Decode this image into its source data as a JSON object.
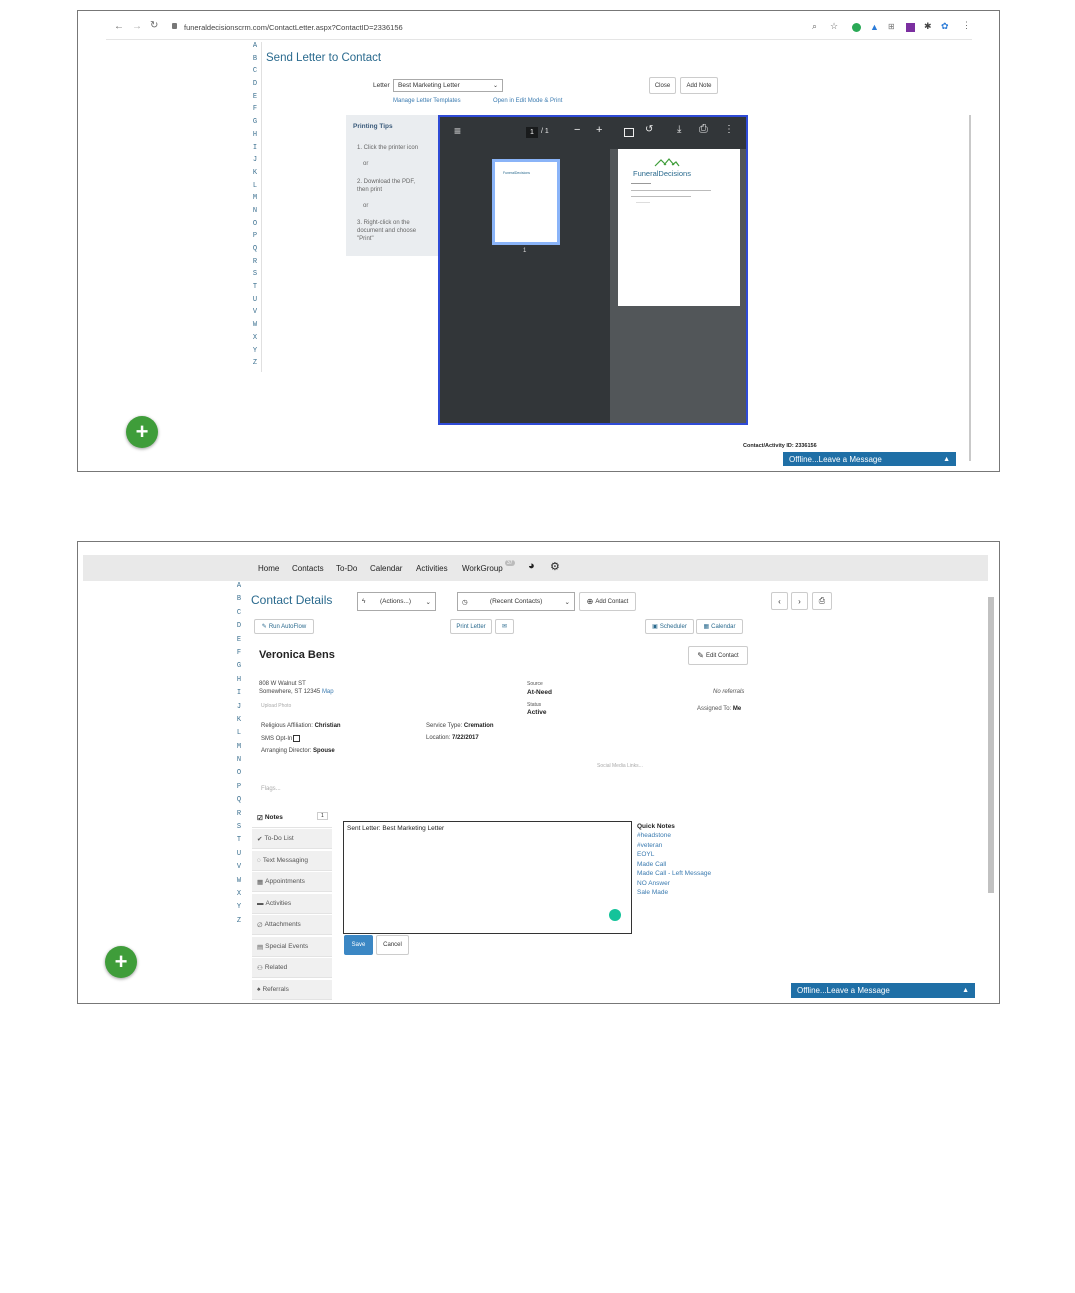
{
  "top": {
    "url": "funeraldecisionscrm.com/ContactLetter.aspx?ContactID=2336156",
    "alphabet": [
      "A",
      "B",
      "C",
      "D",
      "E",
      "F",
      "G",
      "H",
      "I",
      "J",
      "K",
      "L",
      "M",
      "N",
      "O",
      "P",
      "Q",
      "R",
      "S",
      "T",
      "U",
      "V",
      "W",
      "X",
      "Y",
      "Z"
    ],
    "title": "Send Letter to Contact",
    "letter_label": "Letter",
    "letter_value": "Best Marketing Letter",
    "manage_link": "Manage Letter Templates",
    "open_link": "Open in Edit Mode & Print",
    "close_label": "Close",
    "add_note_label": "Add Note",
    "tips_title": "Printing Tips",
    "tip1": "1. Click the printer icon",
    "or1": "or",
    "tip2": "2. Download the PDF, then print",
    "or2": "or",
    "tip3": "3. Right-click on the document and choose \"Print\"",
    "page_current": "1",
    "page_total": "/ 1",
    "thumb_number": "1",
    "brand": "FuneralDecisions",
    "contact_id": "Contact/Activity ID: 2336156",
    "chat": "Offline...Leave a Message"
  },
  "bottom": {
    "nav": [
      "Home",
      "Contacts",
      "To-Do",
      "Calendar",
      "Activities",
      "WorkGroup"
    ],
    "workgroup_badge": "37",
    "alphabet": [
      "A",
      "B",
      "C",
      "D",
      "E",
      "F",
      "G",
      "H",
      "I",
      "J",
      "K",
      "L",
      "M",
      "N",
      "O",
      "P",
      "Q",
      "R",
      "S",
      "T",
      "U",
      "V",
      "W",
      "X",
      "Y",
      "Z"
    ],
    "title": "Contact Details",
    "actions": "(Actions...)",
    "recent": "(Recent Contacts)",
    "add_contact": "Add Contact",
    "run_autoflow": "Run AutoFlow",
    "print_letter": "Print Letter",
    "scheduler": "Scheduler",
    "calendar": "Calendar",
    "edit_contact": "Edit Contact",
    "name": "Veronica Bens",
    "address1": "808 W Walnut ST",
    "address2": "Somewhere, ST 12345",
    "map": "Map",
    "upload_photo": "Upload Photo",
    "source_label": "Source",
    "source_value": "At-Need",
    "status_label": "Status",
    "status_value": "Active",
    "no_referrals": "No referrals",
    "assigned_label": "Assigned To:",
    "assigned_value": "Me",
    "religious_label": "Religious Affiliation:",
    "religious_value": "Christian",
    "sms_label": "SMS Opt-In",
    "director_label": "Arranging Director:",
    "director_value": "Spouse",
    "service_label": "Service Type:",
    "service_value": "Cremation",
    "location_label": "Location:",
    "location_value": "7/22/2017",
    "social": "Social Media Links...",
    "flags": "Flags...",
    "tabs": [
      "Notes",
      "To-Do List",
      "Text Messaging",
      "Appointments",
      "Activities",
      "Attachments",
      "Special Events",
      "Related",
      "Referrals"
    ],
    "notes_count": "1",
    "note_text": "Sent Letter: Best Marketing Letter",
    "quick_title": "Quick Notes",
    "quick_notes": [
      "#headstone",
      "#veteran",
      "EOYL",
      "Made Call",
      "Made Call - Left Message",
      "NO Answer",
      "Sale Made"
    ],
    "save": "Save",
    "cancel": "Cancel",
    "chat": "Offline...Leave a Message"
  }
}
